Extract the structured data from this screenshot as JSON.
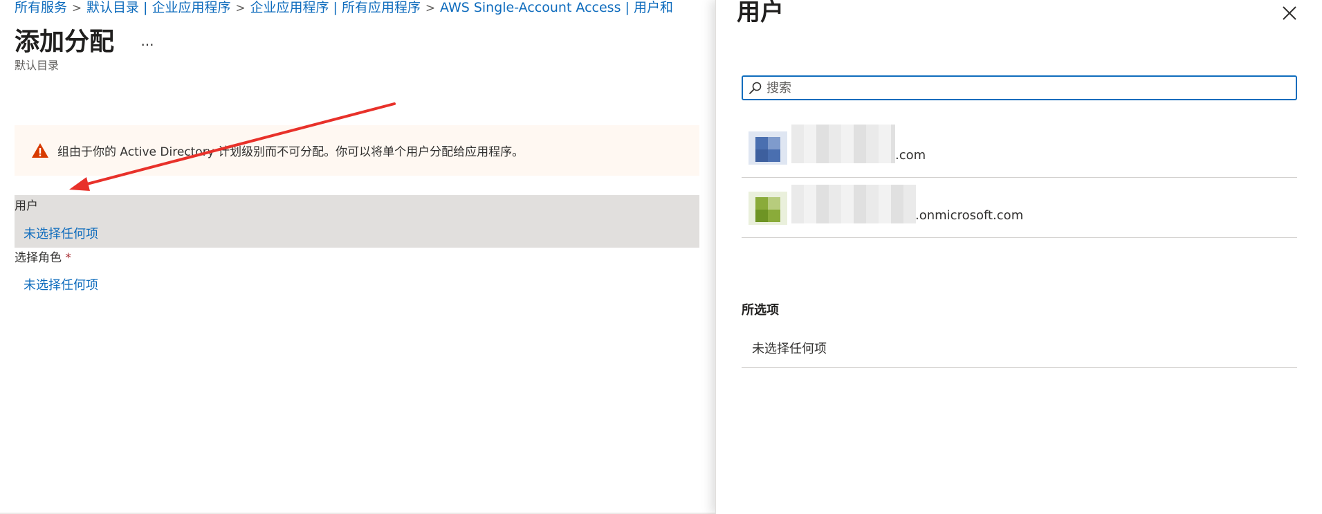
{
  "breadcrumb": {
    "items": [
      "所有服务",
      "默认目录 | 企业应用程序",
      "企业应用程序 | 所有应用程序",
      "AWS Single-Account Access | 用户和"
    ],
    "separator": ">"
  },
  "page": {
    "title": "添加分配",
    "more": "...",
    "subtitle": "默认目录"
  },
  "warning": {
    "text": "组由于你的 Active Directory 计划级别而不可分配。你可以将单个用户分配给应用程序。"
  },
  "form": {
    "users_label": "用户",
    "users_value": "未选择任何项",
    "role_label": "选择角色",
    "role_required": "*",
    "role_value": "未选择任何项"
  },
  "panel": {
    "title": "用户",
    "search_placeholder": "搜索",
    "users": [
      {
        "email_suffix": ".com"
      },
      {
        "email_suffix": ".onmicrosoft.com"
      }
    ],
    "selected_title": "所选项",
    "selected_empty": "未选择任何项"
  },
  "colors": {
    "link": "#0f6cbd",
    "warning_bg": "#fff8f2",
    "warning_icon": "#d83b01",
    "selected_row_bg": "#e1dfdd",
    "annotation_arrow": "#e8312a",
    "avatar1": "#4a6fb0",
    "avatar2": "#8aab3a"
  },
  "icons": {
    "warning": "warning-triangle-icon",
    "search": "search-icon",
    "close": "close-icon"
  }
}
